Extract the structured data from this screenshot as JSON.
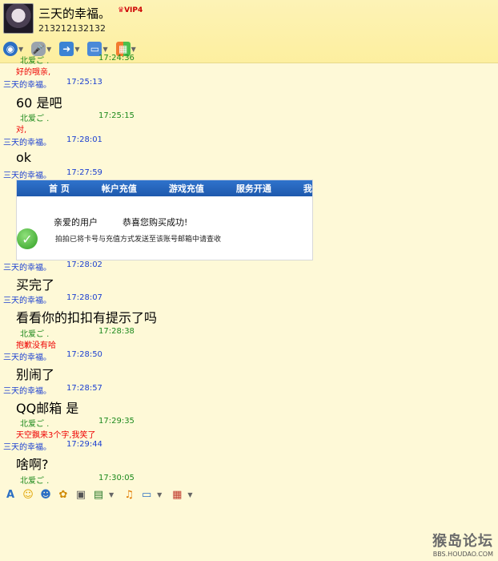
{
  "header": {
    "username": "三天的幸福。",
    "vip_badge": "VIP4",
    "qq_number": "213212132132"
  },
  "toolbar_icons": [
    "camera-icon",
    "microphone-icon",
    "folder-icon",
    "screen-icon",
    "apps-icon"
  ],
  "chat": {
    "top_partial": {
      "sender": "北爱ご .",
      "time": "17:24:36",
      "text": "好的哦亲,"
    },
    "messages": [
      {
        "type": "me",
        "sender": "三天的幸福。",
        "time": "17:25:13",
        "text": "60 是吧"
      },
      {
        "type": "other",
        "sender": "北爱ご .",
        "time": "17:25:15",
        "text": "对,"
      },
      {
        "type": "me",
        "sender": "三天的幸福。",
        "time": "17:28:01",
        "text": "ok"
      },
      {
        "type": "me",
        "sender": "三天的幸福。",
        "time": "17:27:59",
        "text": ""
      },
      {
        "type": "me",
        "sender": "三天的幸福。",
        "time": "17:28:02",
        "text": "买完了"
      },
      {
        "type": "me",
        "sender": "三天的幸福。",
        "time": "17:28:07",
        "text": "看看你的扣扣有提示了吗"
      },
      {
        "type": "other",
        "sender": "北爱ご .",
        "time": "17:28:38",
        "text": "抱歉没有哈"
      },
      {
        "type": "me",
        "sender": "三天的幸福。",
        "time": "17:28:50",
        "text": "别闹了"
      },
      {
        "type": "me",
        "sender": "三天的幸福。",
        "time": "17:28:57",
        "text": "QQ邮箱 是"
      },
      {
        "type": "other",
        "sender": "北爱ご .",
        "time": "17:29:35",
        "text": "天空飘来3个字,我笑了"
      },
      {
        "type": "me",
        "sender": "三天的幸福。",
        "time": "17:29:44",
        "text": "啥啊?"
      },
      {
        "type": "other",
        "sender": "北爱ご .",
        "time": "17:30:05",
        "text": ""
      }
    ],
    "screenshot": {
      "nav": [
        "首 页",
        "帐户充值",
        "游戏充值",
        "服务开通",
        "我"
      ],
      "title": "亲爱的用户",
      "congrats": "恭喜您购买成功!",
      "body": "拍拍已将卡号与充值方式发送至该账号邮箱中请查收"
    }
  },
  "input_toolbar_icons": [
    "font-icon",
    "smiley-icon",
    "face-icon",
    "gift-icon",
    "image-icon",
    "screenshot-icon",
    "music-icon",
    "screen-share-icon",
    "record-icon"
  ],
  "watermark": {
    "title": "猴岛论坛",
    "url": "BBS.HOUDAO.COM"
  }
}
